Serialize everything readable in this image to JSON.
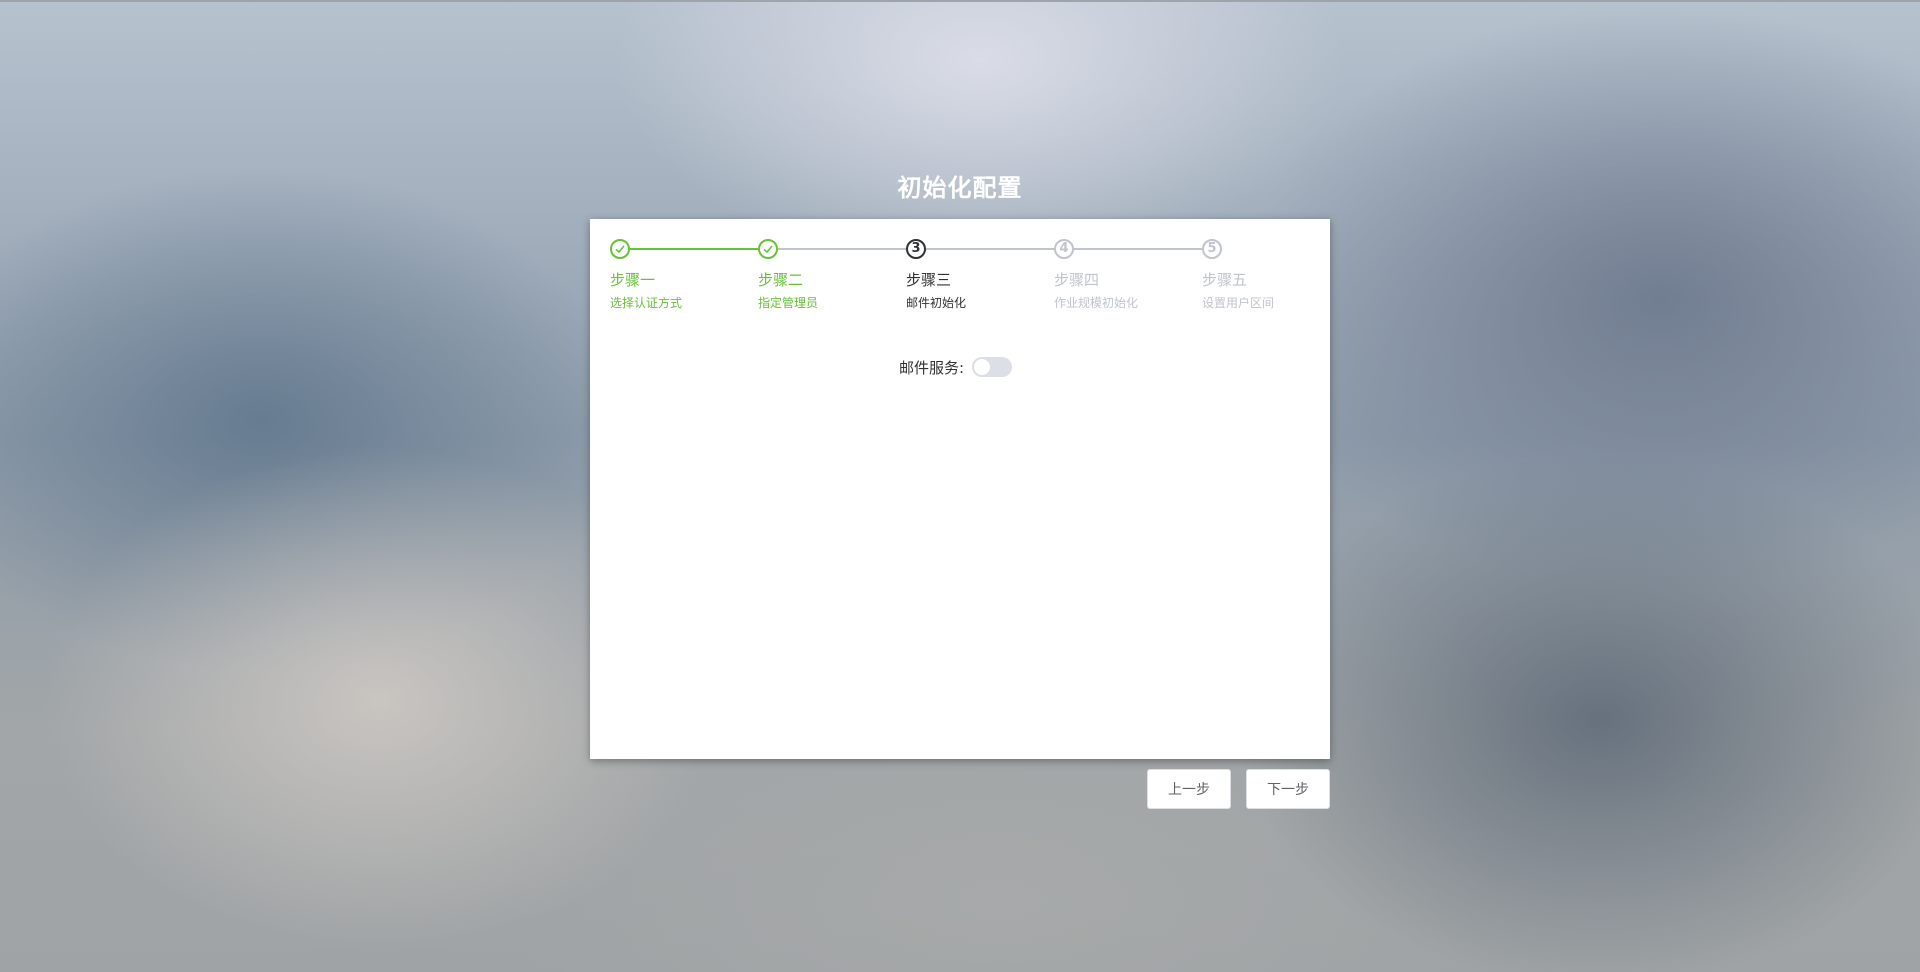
{
  "page": {
    "title": "初始化配置"
  },
  "steps": [
    {
      "number": "1",
      "name": "步骤一",
      "desc": "选择认证方式",
      "state": "done"
    },
    {
      "number": "2",
      "name": "步骤二",
      "desc": "指定管理员",
      "state": "done"
    },
    {
      "number": "3",
      "name": "步骤三",
      "desc": "邮件初始化",
      "state": "current"
    },
    {
      "number": "4",
      "name": "步骤四",
      "desc": "作业规模初始化",
      "state": "pending"
    },
    {
      "number": "5",
      "name": "步骤五",
      "desc": "设置用户区间",
      "state": "pending"
    }
  ],
  "form": {
    "mail_service_label": "邮件服务:",
    "mail_service_enabled": false
  },
  "buttons": {
    "prev_label": "上一步",
    "next_label": "下一步"
  },
  "colors": {
    "done": "#67c23a",
    "current": "#303133",
    "pending": "#c0c4cc"
  }
}
